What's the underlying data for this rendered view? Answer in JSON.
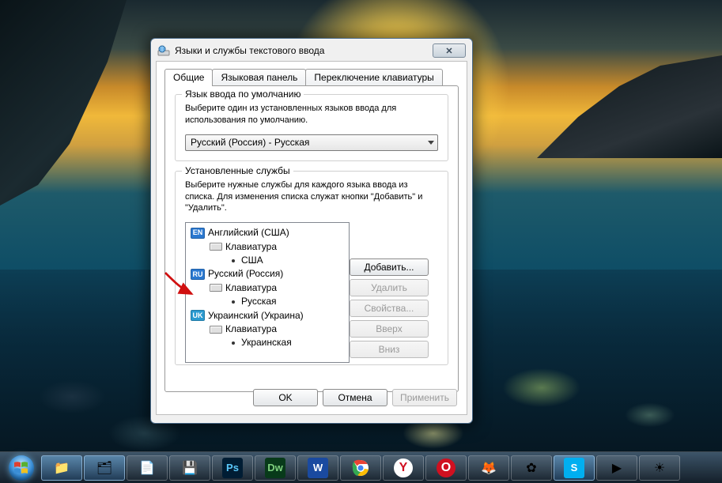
{
  "dialog": {
    "title": "Языки и службы текстового ввода",
    "tabs": [
      {
        "label": "Общие",
        "active": true
      },
      {
        "label": "Языковая панель",
        "active": false
      },
      {
        "label": "Переключение клавиатуры",
        "active": false
      }
    ],
    "default_lang_group": {
      "legend": "Язык ввода по умолчанию",
      "help": "Выберите один из установленных языков ввода для использования по умолчанию.",
      "selected": "Русский (Россия) - Русская"
    },
    "installed_group": {
      "legend": "Установленные службы",
      "help": "Выберите нужные службы для каждого языка ввода из списка. Для изменения списка служат кнопки \"Добавить\" и \"Удалить\".",
      "languages": [
        {
          "badge": "EN",
          "badge_class": "badge-en",
          "name": "Английский (США)",
          "keyboard_label": "Клавиатура",
          "layouts": [
            "США"
          ]
        },
        {
          "badge": "RU",
          "badge_class": "badge-ru",
          "name": "Русский (Россия)",
          "keyboard_label": "Клавиатура",
          "layouts": [
            "Русская"
          ]
        },
        {
          "badge": "UK",
          "badge_class": "badge-uk",
          "name": "Украинский (Украина)",
          "keyboard_label": "Клавиатура",
          "layouts": [
            "Украинская"
          ]
        }
      ],
      "buttons": {
        "add": "Добавить...",
        "remove": "Удалить",
        "properties": "Свойства...",
        "move_up": "Вверх",
        "move_down": "Вниз"
      }
    },
    "bottom": {
      "ok": "OK",
      "cancel": "Отмена",
      "apply": "Применить"
    }
  },
  "taskbar": {
    "items": [
      {
        "name": "start",
        "glyph": "win"
      },
      {
        "name": "explorer",
        "glyph": "📁",
        "lit": true
      },
      {
        "name": "libraries",
        "glyph": "🗂",
        "lit": true
      },
      {
        "name": "notepad",
        "glyph": "📄"
      },
      {
        "name": "save",
        "glyph": "💾"
      },
      {
        "name": "photoshop",
        "glyph": "Ps"
      },
      {
        "name": "dreamweaver",
        "glyph": "Dw"
      },
      {
        "name": "word",
        "glyph": "W"
      },
      {
        "name": "chrome",
        "glyph": "◐"
      },
      {
        "name": "yandex",
        "glyph": "Y"
      },
      {
        "name": "opera",
        "glyph": "O"
      },
      {
        "name": "firefox",
        "glyph": "🦊"
      },
      {
        "name": "icq",
        "glyph": "✿"
      },
      {
        "name": "skype",
        "glyph": "S",
        "lit": true
      },
      {
        "name": "media",
        "glyph": "▶"
      },
      {
        "name": "weather",
        "glyph": "☀"
      }
    ]
  }
}
